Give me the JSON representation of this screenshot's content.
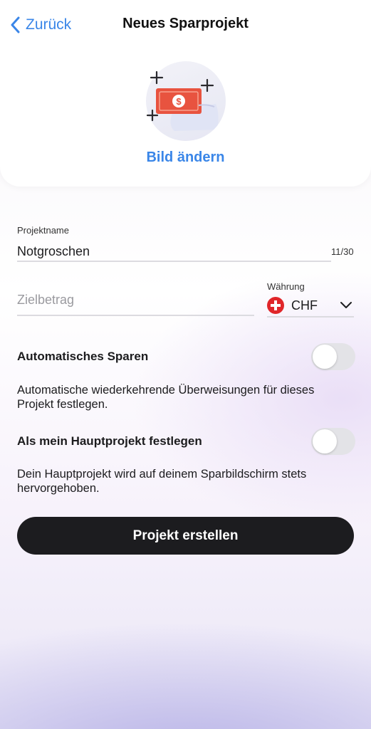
{
  "header": {
    "back_label": "Zurück",
    "title": "Neues Sparprojekt",
    "change_image_label": "Bild ändern"
  },
  "form": {
    "project_name": {
      "label": "Projektname",
      "value": "Notgroschen",
      "counter": "11/30"
    },
    "target_amount": {
      "placeholder": "Zielbetrag",
      "value": ""
    },
    "currency": {
      "label": "Währung",
      "selected": "CHF",
      "flag": "swiss-flag-icon"
    }
  },
  "options": {
    "auto_save": {
      "title": "Automatisches Sparen",
      "description": "Automatische wiederkehrende Überweisungen für dieses Projekt festlegen.",
      "enabled": false
    },
    "main_project": {
      "title": "Als mein Hauptprojekt festlegen",
      "description": "Dein Hauptprojekt wird auf deinem Sparbildschirm stets hervorgehoben.",
      "enabled": false
    }
  },
  "actions": {
    "create_label": "Projekt erstellen"
  },
  "colors": {
    "accent": "#3a86e8",
    "primary_button": "#1c1c1f",
    "money_icon": "#e8533f"
  }
}
